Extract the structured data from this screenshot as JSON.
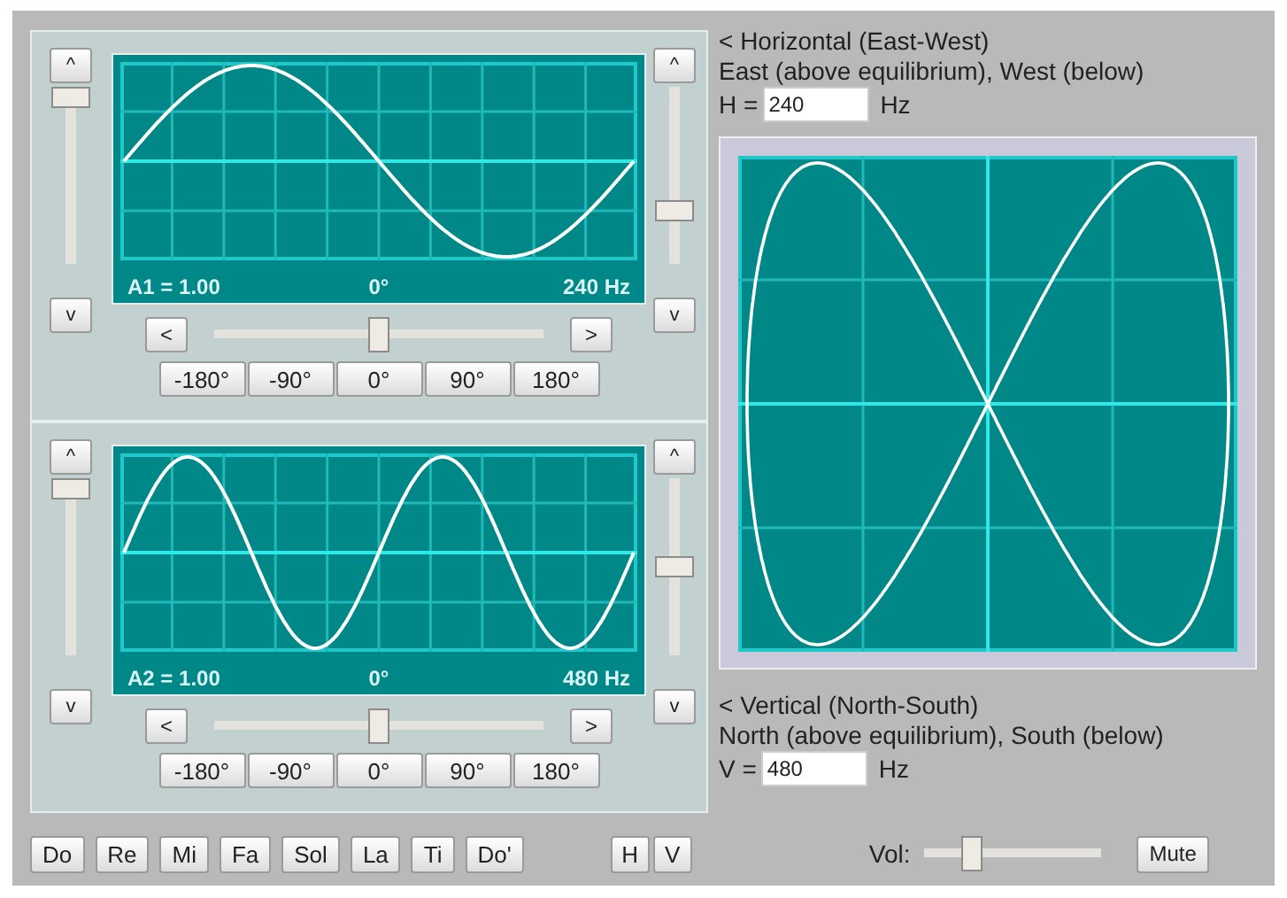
{
  "channels": [
    {
      "amp_up": "^",
      "amp_down": "v",
      "amplitude_slider": {
        "level": 1
      },
      "freq_up": "^",
      "freq_down": "v",
      "frequency_slider": {
        "level": 0.27
      },
      "readout": {
        "amplitude": "A1 = 1.00",
        "phase": "0°",
        "frequency": "240 Hz"
      },
      "phase_left": "<",
      "phase_right": ">",
      "phase_slider": {
        "level": 0.5
      },
      "phase_buttons": [
        "-180°",
        "-90°",
        "0°",
        "90°",
        "180°"
      ]
    },
    {
      "amp_up": "^",
      "amp_down": "v",
      "amplitude_slider": {
        "level": 1
      },
      "freq_up": "^",
      "freq_down": "v",
      "frequency_slider": {
        "level": 0.5
      },
      "readout": {
        "amplitude": "A2 = 1.00",
        "phase": "0°",
        "frequency": "480 Hz"
      },
      "phase_left": "<",
      "phase_right": ">",
      "phase_slider": {
        "level": 0.5
      },
      "phase_buttons": [
        "-180°",
        "-90°",
        "0°",
        "90°",
        "180°"
      ]
    }
  ],
  "horizontal": {
    "title": "< Horizontal (East-West)",
    "description": "East (above equilibrium), West (below)",
    "field_label": "H =",
    "value": "240",
    "unit": "Hz"
  },
  "vertical": {
    "title": "< Vertical (North-South)",
    "description": "North (above equilibrium), South (below)",
    "field_label": "V =",
    "value": "480",
    "unit": "Hz"
  },
  "note_buttons": [
    "Do",
    "Re",
    "Mi",
    "Fa",
    "Sol",
    "La",
    "Ti",
    "Do'"
  ],
  "axis_buttons": [
    "H",
    "V"
  ],
  "volume": {
    "label": "Vol:",
    "level": 0.24
  },
  "mute_button": "Mute"
}
